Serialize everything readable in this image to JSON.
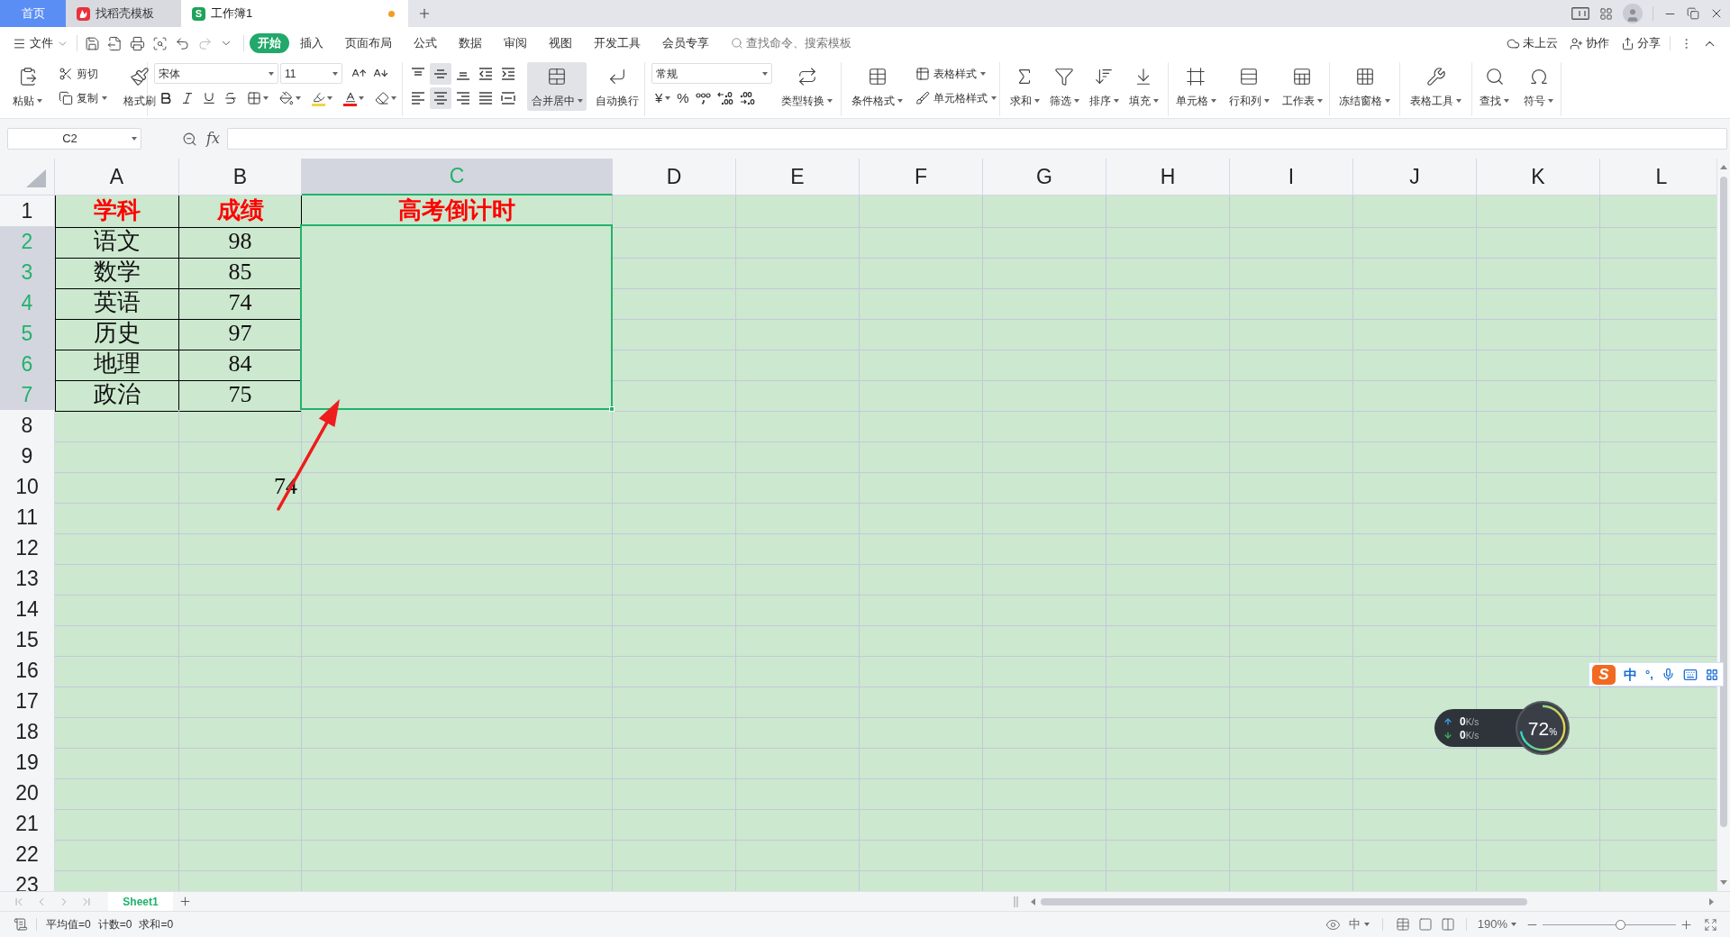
{
  "title_bar": {
    "tabs": [
      {
        "label": "首页",
        "kind": "home",
        "selected": false
      },
      {
        "label": "找稻壳模板",
        "kind": "template",
        "selected": false
      },
      {
        "label": "工作簿1",
        "kind": "workbook",
        "selected": true,
        "unsaved": true,
        "badge": "S"
      }
    ]
  },
  "menu_bar": {
    "file": "文件",
    "tabs": [
      {
        "label": "开始",
        "selected": true
      },
      {
        "label": "插入",
        "selected": false
      },
      {
        "label": "页面布局",
        "selected": false
      },
      {
        "label": "公式",
        "selected": false
      },
      {
        "label": "数据",
        "selected": false
      },
      {
        "label": "审阅",
        "selected": false
      },
      {
        "label": "视图",
        "selected": false
      },
      {
        "label": "开发工具",
        "selected": false
      },
      {
        "label": "会员专享",
        "selected": false
      }
    ],
    "search": {
      "placeholder": "查找命令、搜索模板"
    },
    "actions": [
      "未上云",
      "协作",
      "分享"
    ]
  },
  "ribbon": {
    "clipboard": {
      "paste": "粘贴",
      "cut": "剪切",
      "copy": "复制",
      "format_painter": "格式刷"
    },
    "font": {
      "name": "宋体",
      "size": "11"
    },
    "alignment": {
      "buttons": [
        {
          "selected": false
        },
        {
          "selected": true
        },
        {
          "selected": false
        },
        {
          "selected": false
        },
        {
          "selected": false
        },
        {
          "selected": false
        },
        {
          "selected": true
        },
        {
          "selected": false
        },
        {
          "selected": false
        },
        {
          "selected": false
        }
      ],
      "merge": {
        "label": "合并居中",
        "selected": true
      },
      "wrap": {
        "label": "自动换行",
        "selected": false
      }
    },
    "number": {
      "format": "常规",
      "currency": "¥",
      "percent": "%",
      "convert": "类型转换"
    },
    "styles": {
      "conditional": "条件格式",
      "table_style": "表格样式",
      "cell_style": "单元格样式"
    },
    "tool_groups": [
      [
        "求和",
        "筛选",
        "排序",
        "填充"
      ],
      [
        "单元格",
        "行和列",
        "工作表"
      ],
      [
        "冻结窗格"
      ],
      [
        "表格工具"
      ],
      [
        "查找",
        "符号"
      ]
    ]
  },
  "formula_bar": {
    "name_box": "C2",
    "function_button": "fx"
  },
  "sheet": {
    "columns": [
      {
        "label": "A",
        "selected": false
      },
      {
        "label": "B",
        "selected": false
      },
      {
        "label": "C",
        "selected": true
      },
      {
        "label": "D",
        "selected": false
      },
      {
        "label": "E",
        "selected": false
      },
      {
        "label": "F",
        "selected": false
      },
      {
        "label": "G",
        "selected": false
      },
      {
        "label": "H",
        "selected": false
      },
      {
        "label": "I",
        "selected": false
      },
      {
        "label": "J",
        "selected": false
      },
      {
        "label": "K",
        "selected": false
      },
      {
        "label": "L",
        "selected": false
      }
    ],
    "rows": [
      {
        "label": "1",
        "selected": false,
        "kind": "header",
        "cells": {
          "col_1": {
            "text": "学科",
            "bordered": true,
            "centered": true
          },
          "col_2": {
            "text": "成绩",
            "bordered": true,
            "centered": true
          },
          "col_3": {
            "text": "高考倒计时",
            "bordered": false,
            "centered": true
          }
        }
      },
      {
        "label": "2",
        "selected": true,
        "kind": "data",
        "cells": {
          "col_1": {
            "text": "语文",
            "bordered": true,
            "centered": true
          },
          "col_2": {
            "text": "98",
            "bordered": true,
            "centered": true
          }
        }
      },
      {
        "label": "3",
        "selected": true,
        "kind": "data",
        "cells": {
          "col_1": {
            "text": "数学",
            "bordered": true,
            "centered": true
          },
          "col_2": {
            "text": "85",
            "bordered": true,
            "centered": true
          }
        }
      },
      {
        "label": "4",
        "selected": true,
        "kind": "data",
        "cells": {
          "col_1": {
            "text": "英语",
            "bordered": true,
            "centered": true
          },
          "col_2": {
            "text": "74",
            "bordered": true,
            "centered": true
          }
        }
      },
      {
        "label": "5",
        "selected": true,
        "kind": "data",
        "cells": {
          "col_1": {
            "text": "历史",
            "bordered": true,
            "centered": true
          },
          "col_2": {
            "text": "97",
            "bordered": true,
            "centered": true
          }
        }
      },
      {
        "label": "6",
        "selected": true,
        "kind": "data",
        "cells": {
          "col_1": {
            "text": "地理",
            "bordered": true,
            "centered": true
          },
          "col_2": {
            "text": "84",
            "bordered": true,
            "centered": true
          }
        }
      },
      {
        "label": "7",
        "selected": true,
        "kind": "data",
        "cells": {
          "col_1": {
            "text": "政治",
            "bordered": true,
            "centered": true
          },
          "col_2": {
            "text": "75",
            "bordered": true,
            "centered": true
          }
        }
      },
      {
        "label": "8",
        "selected": false,
        "kind": "data"
      },
      {
        "label": "9",
        "selected": false,
        "kind": "data"
      },
      {
        "label": "10",
        "selected": false,
        "kind": "data",
        "cells": {
          "col_2": {
            "text": "74",
            "bordered": false,
            "centered": false
          }
        }
      },
      {
        "label": "11",
        "selected": false,
        "kind": "data"
      },
      {
        "label": "12",
        "selected": false,
        "kind": "data"
      },
      {
        "label": "13",
        "selected": false,
        "kind": "data"
      },
      {
        "label": "14",
        "selected": false,
        "kind": "data"
      },
      {
        "label": "15",
        "selected": false,
        "kind": "data"
      },
      {
        "label": "16",
        "selected": false,
        "kind": "data"
      },
      {
        "label": "17",
        "selected": false,
        "kind": "data"
      },
      {
        "label": "18",
        "selected": false,
        "kind": "data"
      },
      {
        "label": "19",
        "selected": false,
        "kind": "data"
      },
      {
        "label": "20",
        "selected": false,
        "kind": "data"
      },
      {
        "label": "21",
        "selected": false,
        "kind": "data"
      },
      {
        "label": "22",
        "selected": false,
        "kind": "data"
      },
      {
        "label": "23",
        "selected": false,
        "kind": "data"
      }
    ],
    "selection": {
      "merged": true
    }
  },
  "sheet_tabs": [
    {
      "label": "Sheet1",
      "selected": true
    }
  ],
  "status_bar": {
    "summary": [
      "平均值=0",
      "计数=0",
      "求和=0"
    ],
    "input_mode": "中",
    "zoom": {
      "value": "190%",
      "level": 0.58
    }
  },
  "ime_toolbar": {
    "logo": "S",
    "mode": "中",
    "punctuation": "°,"
  },
  "network_monitor": {
    "upload": {
      "value": "0",
      "unit": "K/s"
    },
    "download": {
      "value": "0",
      "unit": "K/s"
    },
    "usage": {
      "value": "72",
      "unit": "%"
    }
  }
}
